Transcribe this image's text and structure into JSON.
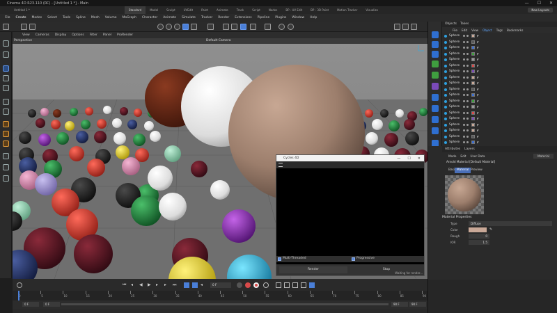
{
  "window": {
    "title": "Cinema 4D R23.110 (RC) - [Untitled 1 *] - Main",
    "controls": [
      "—",
      "☐",
      "✕"
    ]
  },
  "tabs": {
    "file_tab": "Untitled 1 *",
    "layouts": [
      "Standard",
      "Model",
      "Sculpt",
      "UVEdit",
      "Paint",
      "Animate",
      "Track",
      "Script",
      "Nodes",
      "BP - UV Edit",
      "BP - 3D Paint",
      "Motion Tracker",
      "Visualize"
    ],
    "new_layout": "New Layouts"
  },
  "main_menu": [
    "File",
    "Create",
    "Modes",
    "Select",
    "Tools",
    "Spline",
    "Mesh",
    "Volume",
    "MoGraph",
    "Character",
    "Animate",
    "Simulate",
    "Tracker",
    "Render",
    "Extensions",
    "Pipeline",
    "Plugins",
    "Window",
    "Help"
  ],
  "viewport": {
    "menu": [
      "View",
      "Cameras",
      "Display",
      "Options",
      "Filter",
      "Panel",
      "ProRender"
    ],
    "perspective_label": "Perspective",
    "camera_label": "Default Camera"
  },
  "render_window": {
    "title": "Cycles 4D",
    "multi_threaded_label": "Multi-Threaded",
    "progressive_label": "Progressive",
    "render_button": "Render",
    "stop_button": "Stop",
    "status": "Waiting for render..."
  },
  "object_manager": {
    "tabs": [
      "Objects",
      "Takes"
    ],
    "menu": [
      "File",
      "Edit",
      "View",
      "Object",
      "Tags",
      "Bookmarks"
    ],
    "rows": [
      "Sphere",
      "Sphere",
      "Sphere",
      "Sphere",
      "Sphere",
      "Sphere",
      "Sphere",
      "Sphere",
      "Sphere",
      "Sphere",
      "Sphere",
      "Sphere",
      "Sphere",
      "Sphere",
      "Sphere",
      "Sphere",
      "Sphere",
      "Sphere",
      "Sphere",
      "Sphere"
    ]
  },
  "attributes": {
    "tabs": [
      "Attributes",
      "Layers"
    ],
    "menu": [
      "Mode",
      "Edit",
      "User Data"
    ],
    "mode_select": "Material",
    "title": "Arnold Material [Default Material]",
    "subtabs": [
      "Basic",
      "Material",
      "Preview"
    ],
    "section": "Material Properties",
    "props": [
      {
        "label": "Type",
        "value": "Diffuse"
      },
      {
        "label": "Color",
        "value": ""
      },
      {
        "label": "Rough",
        "value": "0"
      },
      {
        "label": "IOR",
        "value": "1.5"
      }
    ],
    "accent_color": "#c9a897"
  },
  "timeline": {
    "frame_current": "0 F",
    "ruler_ticks": [
      "0",
      "5",
      "10",
      "15",
      "20",
      "25",
      "30",
      "35",
      "40",
      "45",
      "50",
      "55",
      "60",
      "65",
      "70",
      "75",
      "80",
      "85",
      "90"
    ],
    "start": "0 F",
    "min": "0 F",
    "end": "90 F",
    "max": "90 F"
  },
  "colors": {
    "accent_blue": "#4a7fd8",
    "record_red": "#d84a4a",
    "sphere_highlight": "#ffffff",
    "large_sphere": "#9b7e6c"
  }
}
